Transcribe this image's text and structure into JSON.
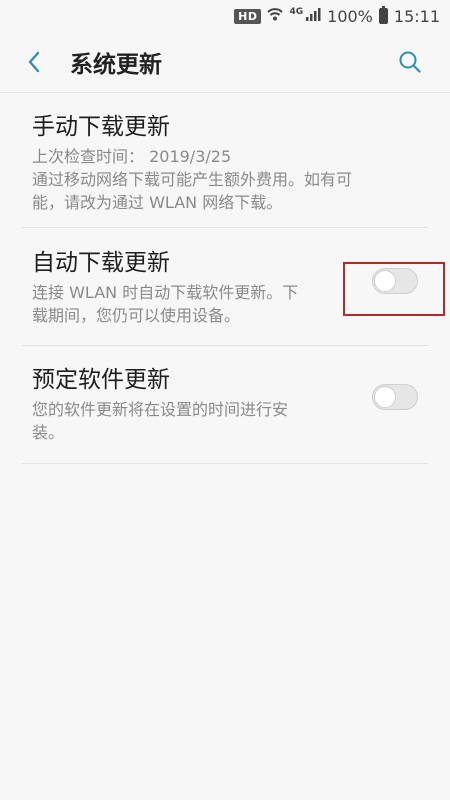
{
  "status_bar": {
    "hd": "HD",
    "network": "4G",
    "battery": "100%",
    "time": "15:11"
  },
  "header": {
    "title": "系统更新",
    "back_icon": "chevron-left-icon",
    "search_icon": "search-icon",
    "accent_color": "#2f8fb0"
  },
  "items": [
    {
      "title": "手动下载更新",
      "desc_lines": [
        "上次检查时间： 2019/3/25",
        "通过移动网络下载可能产生额外费用。如有可",
        "能，请改为通过 WLAN 网络下载。"
      ]
    },
    {
      "title": "自动下载更新",
      "desc_lines": [
        "连接 WLAN 时自动下载软件更新。下",
        "载期间，您仍可以使用设备。"
      ],
      "toggle": "off"
    },
    {
      "title": "预定软件更新",
      "desc_lines": [
        "您的软件更新将在设置的时间进行安",
        "装。"
      ],
      "toggle": "off"
    }
  ]
}
